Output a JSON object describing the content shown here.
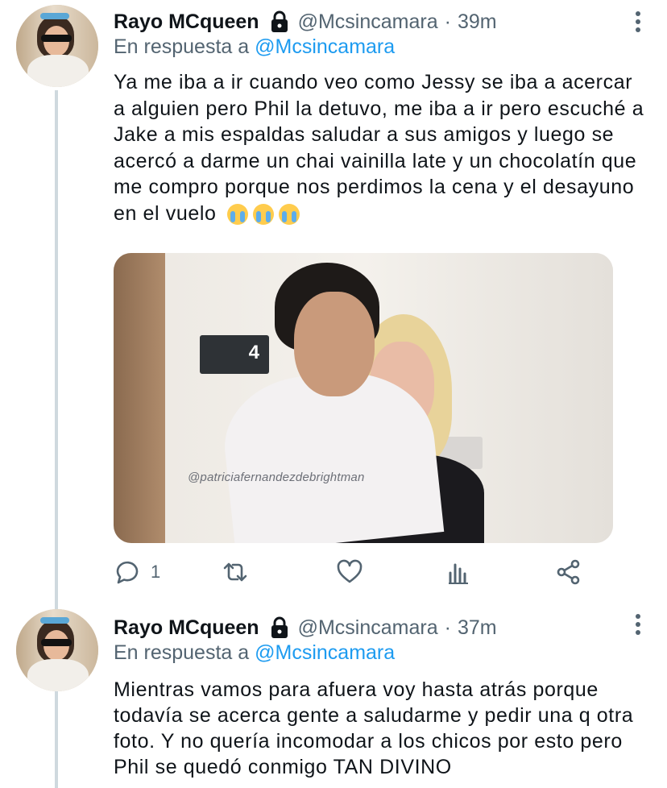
{
  "tweets": [
    {
      "author_name": "Rayo MCqueen",
      "handle": "@Mcsincamara",
      "separator": "·",
      "time": "39m",
      "reply_prefix": "En respuesta a",
      "reply_to": "@Mcsincamara",
      "text": "Ya me iba a ir cuando veo como Jessy se iba a acercar a alguien pero Phil la detuvo, me iba a ir pero escuché a Jake a mis espaldas saludar a sus amigos y luego se acercó a darme un chai vainilla late y un chocolatín que me compro porque nos perdimos la cena y el desayuno en el vuelo",
      "emojis": [
        "crying-face",
        "crying-face",
        "crying-face"
      ],
      "media": {
        "sign_number": "4",
        "watermark": "@patriciafernandezdebrightman"
      },
      "actions": {
        "reply_count": "1"
      }
    },
    {
      "author_name": "Rayo MCqueen",
      "handle": "@Mcsincamara",
      "separator": "·",
      "time": "37m",
      "reply_prefix": "En respuesta a",
      "reply_to": "@Mcsincamara",
      "text": "Mientras vamos para afuera voy hasta atrás porque todavía se acerca gente a saludarme y pedir una q otra foto. Y no quería incomodar a los chicos por esto pero Phil se quedó conmigo TAN DIVINO"
    }
  ],
  "colors": {
    "accent": "#1d9bf0",
    "secondary_text": "#536471",
    "primary_text": "#0f1419",
    "thread_line": "#cfd9de"
  },
  "icons": [
    "lock-icon",
    "more-vertical-icon",
    "reply-icon",
    "retweet-icon",
    "like-icon",
    "analytics-icon",
    "share-icon"
  ]
}
